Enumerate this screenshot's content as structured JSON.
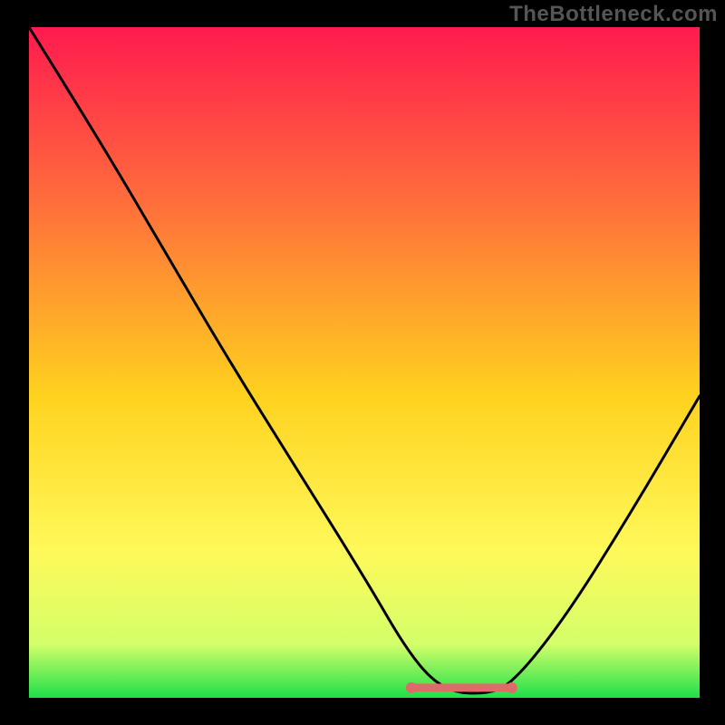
{
  "watermark": "TheBottleneck.com",
  "chart_data": {
    "type": "line",
    "title": "",
    "xlabel": "",
    "ylabel": "",
    "xlim": [
      0,
      100
    ],
    "ylim": [
      0,
      100
    ],
    "grid": false,
    "legend": false,
    "background_gradient": {
      "stops": [
        {
          "offset": 0,
          "color": "#ff1a4f"
        },
        {
          "offset": 25,
          "color": "#ff6a3c"
        },
        {
          "offset": 55,
          "color": "#ffd21f"
        },
        {
          "offset": 78,
          "color": "#fff95a"
        },
        {
          "offset": 92,
          "color": "#d3ff6a"
        },
        {
          "offset": 100,
          "color": "#1fdf4a"
        }
      ]
    },
    "series": [
      {
        "name": "bottleneck-curve",
        "stroke": "#000000",
        "x": [
          0,
          10,
          20,
          30,
          40,
          50,
          57,
          62,
          68,
          72,
          80,
          90,
          100
        ],
        "values": [
          100,
          84,
          67,
          50,
          34,
          18,
          6,
          1,
          0.5,
          2,
          12,
          28,
          45
        ]
      }
    ],
    "flat_marker": {
      "color": "#e06a6a",
      "x": [
        57,
        72
      ],
      "y": 1.5,
      "caps": true
    }
  }
}
